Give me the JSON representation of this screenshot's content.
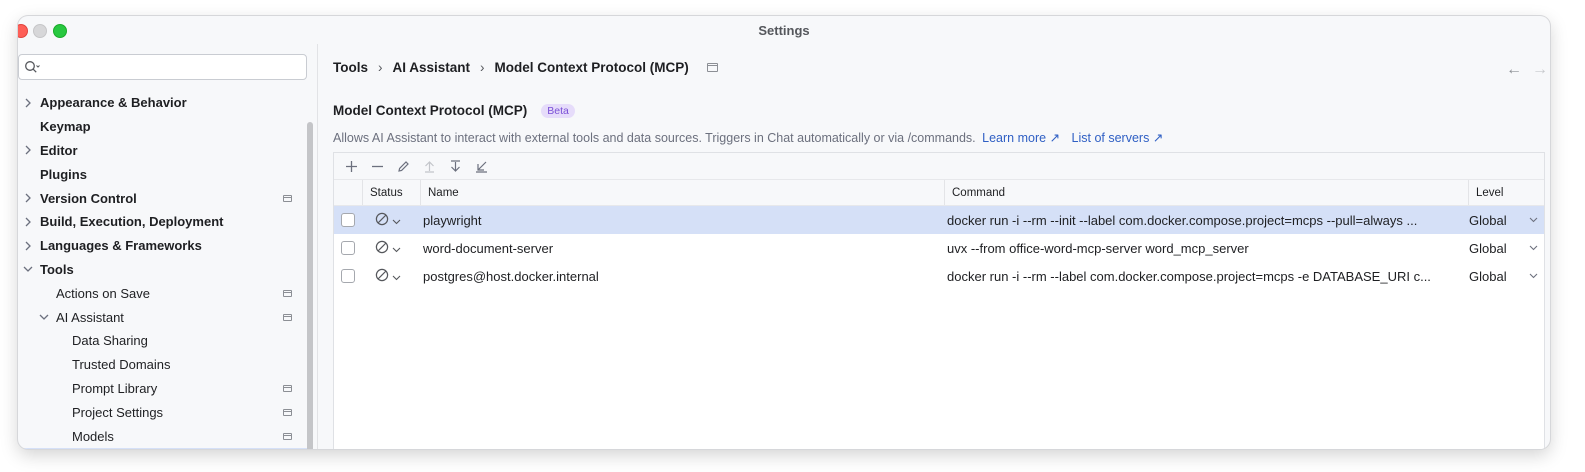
{
  "window": {
    "title": "Settings"
  },
  "search": {
    "placeholder": ""
  },
  "sidebar": {
    "items": [
      {
        "label": "Appearance & Behavior",
        "bold": true,
        "chevron": "right",
        "pinned": false
      },
      {
        "label": "Keymap",
        "bold": true,
        "chevron": "",
        "pinned": false
      },
      {
        "label": "Editor",
        "bold": true,
        "chevron": "right",
        "pinned": false
      },
      {
        "label": "Plugins",
        "bold": true,
        "chevron": "",
        "pinned": false
      },
      {
        "label": "Version Control",
        "bold": true,
        "chevron": "right",
        "pinned": true
      },
      {
        "label": "Build, Execution, Deployment",
        "bold": true,
        "chevron": "right",
        "pinned": false
      },
      {
        "label": "Languages & Frameworks",
        "bold": true,
        "chevron": "right",
        "pinned": false
      },
      {
        "label": "Tools",
        "bold": true,
        "chevron": "down",
        "pinned": false
      },
      {
        "label": "Actions on Save",
        "bold": false,
        "chevron": "",
        "pinned": true
      },
      {
        "label": "AI Assistant",
        "bold": false,
        "chevron": "down",
        "pinned": true
      },
      {
        "label": "Data Sharing",
        "bold": false,
        "chevron": "",
        "pinned": false
      },
      {
        "label": "Trusted Domains",
        "bold": false,
        "chevron": "",
        "pinned": false
      },
      {
        "label": "Prompt Library",
        "bold": false,
        "chevron": "",
        "pinned": true
      },
      {
        "label": "Project Settings",
        "bold": false,
        "chevron": "",
        "pinned": true
      },
      {
        "label": "Models",
        "bold": false,
        "chevron": "",
        "pinned": true
      }
    ]
  },
  "breadcrumb": {
    "items": [
      "Tools",
      "AI Assistant",
      "Model Context Protocol (MCP)"
    ],
    "separator": "›"
  },
  "nav": {
    "back": "←",
    "forward": "→"
  },
  "section": {
    "title": "Model Context Protocol (MCP)",
    "badge": "Beta",
    "description": "Allows AI Assistant to interact with external tools and data sources. Triggers in Chat automatically or via /commands.",
    "learn_more": "Learn more ↗",
    "list_servers": "List of servers ↗"
  },
  "toolbar": {
    "icons": [
      "add-icon",
      "remove-icon",
      "edit-icon",
      "move-up-icon",
      "move-down-icon",
      "import-icon"
    ]
  },
  "table": {
    "columns": {
      "status": "Status",
      "name": "Name",
      "command": "Command",
      "level": "Level"
    },
    "rows": [
      {
        "name": "playwright",
        "command": "docker run -i --rm --init --label com.docker.compose.project=mcps --pull=always ...",
        "level": "Global",
        "selected": true
      },
      {
        "name": "word-document-server",
        "command": "uvx --from office-word-mcp-server word_mcp_server",
        "level": "Global",
        "selected": false
      },
      {
        "name": "postgres@host.docker.internal",
        "command": "docker run -i --rm --label com.docker.compose.project=mcps -e DATABASE_URI c...",
        "level": "Global",
        "selected": false
      }
    ]
  },
  "colors": {
    "accent": "#2f5fc4",
    "selection": "#d5e0f7",
    "beta_bg": "#e6dcfa",
    "beta_fg": "#7a4fd6"
  }
}
